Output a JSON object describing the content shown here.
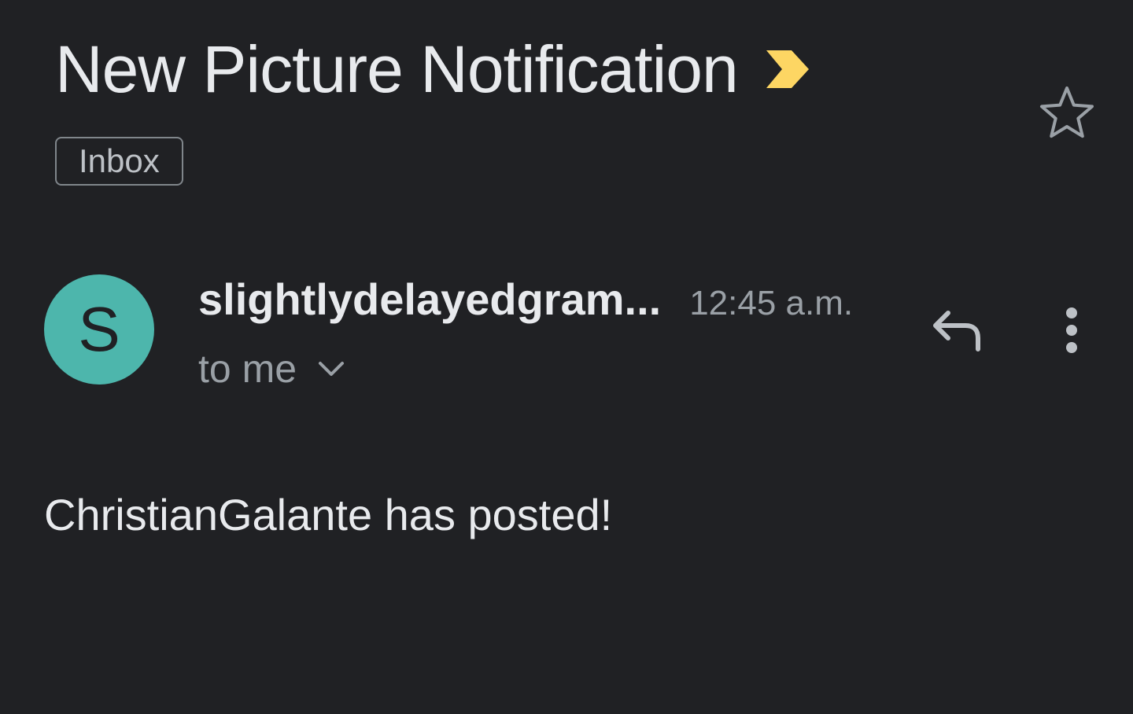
{
  "email": {
    "subject": "New Picture Notification",
    "label": "Inbox",
    "sender_initial": "S",
    "sender_name": "slightlydelayedgram...",
    "time": "12:45 a.m.",
    "recipient": "to me",
    "body": "ChristianGalante has posted!"
  },
  "icons": {
    "importance": "importance-marker-icon",
    "star": "star-outline-icon",
    "chevron": "chevron-down-icon",
    "reply": "reply-icon",
    "more": "more-vert-icon"
  },
  "colors": {
    "background": "#202124",
    "avatar": "#4db6ac",
    "importance": "#fdd663",
    "muted_text": "#9aa0a6",
    "primary_text": "#e8eaed"
  }
}
